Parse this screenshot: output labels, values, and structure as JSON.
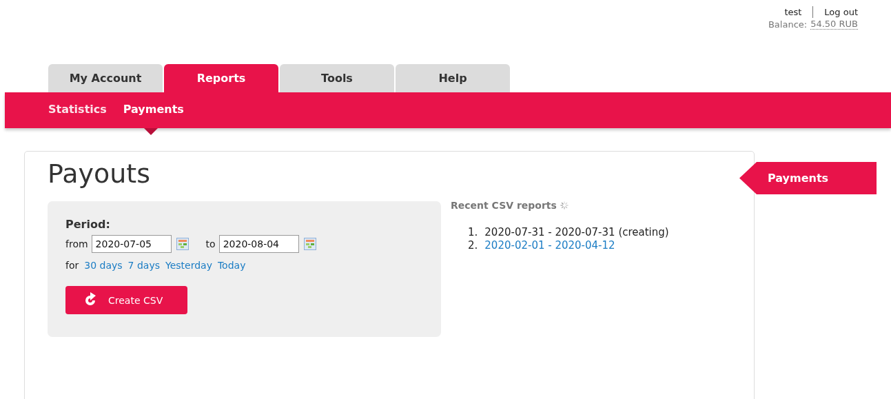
{
  "user": {
    "name": "test",
    "logout": "Log out",
    "balance_label": "Balance:",
    "balance": "54.50 RUB"
  },
  "tabs": [
    {
      "label": "My Account",
      "selected": false
    },
    {
      "label": "Reports",
      "selected": true
    },
    {
      "label": "Tools",
      "selected": false
    },
    {
      "label": "Help",
      "selected": false
    }
  ],
  "subnav": [
    {
      "label": "Statistics",
      "selected": false
    },
    {
      "label": "Payments",
      "selected": true
    }
  ],
  "page": {
    "title": "Payouts",
    "side_tag": "Payments"
  },
  "period": {
    "label": "Period:",
    "from_label": "from",
    "from": "2020-07-05",
    "to_label": "to",
    "to": "2020-08-04",
    "for_label": "for",
    "shortcuts": [
      "30 days",
      "7 days",
      "Yesterday",
      "Today"
    ],
    "button": "Create CSV"
  },
  "reports": {
    "title": "Recent CSV reports",
    "loading": true,
    "items": [
      {
        "number": "1.",
        "text": "2020-07-31 - 2020-07-31 (creating)",
        "link": false
      },
      {
        "number": "2.",
        "text": "2020-02-01 - 2020-04-12",
        "link": true
      }
    ]
  }
}
